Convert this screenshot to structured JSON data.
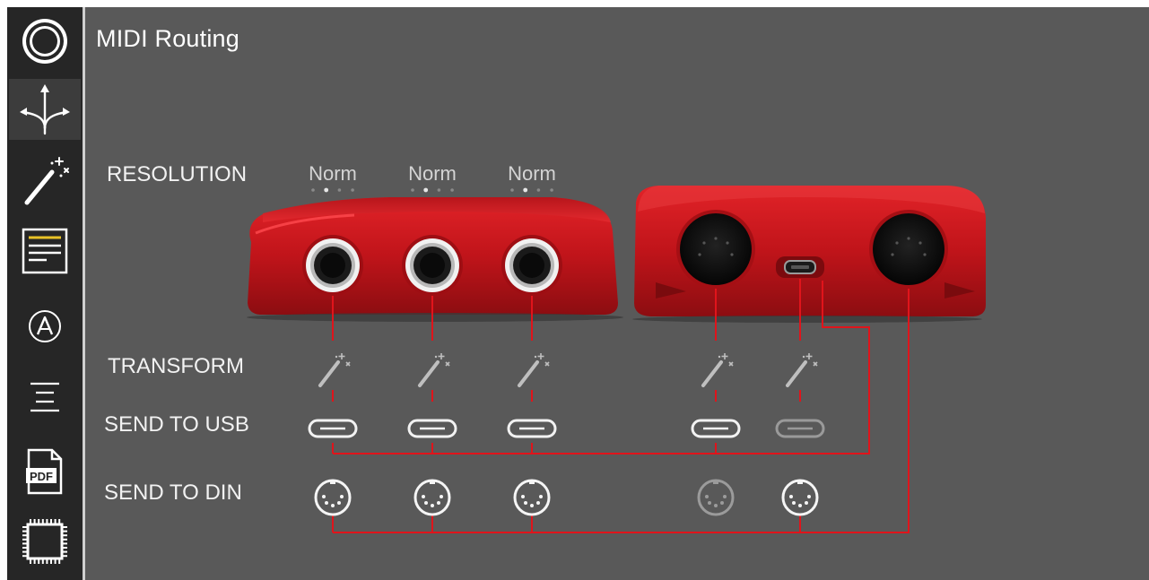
{
  "sidebar": {
    "items": [
      {
        "name": "record-icon",
        "active": false
      },
      {
        "name": "routing-arrows-icon",
        "active": true
      },
      {
        "name": "magic-wand-icon",
        "active": false
      },
      {
        "name": "text-panel-icon",
        "active": false
      },
      {
        "name": "circle-a-icon",
        "active": false
      },
      {
        "name": "list-icon",
        "active": false
      },
      {
        "name": "pdf-icon",
        "active": false,
        "label": "PDF"
      },
      {
        "name": "chip-icon",
        "active": false
      }
    ]
  },
  "page": {
    "title": "MIDI Routing",
    "row_labels": {
      "resolution": "RESOLUTION",
      "transform": "TRANSFORM",
      "send_usb": "SEND TO USB",
      "send_din": "SEND TO DIN"
    },
    "resolution_values": [
      "Norm",
      "Norm",
      "Norm"
    ],
    "resolution_steps": 4,
    "resolution_selected_index": 1
  },
  "ports": [
    {
      "id": "jack-1",
      "type": "jack",
      "send_to_usb": true,
      "send_to_din": true
    },
    {
      "id": "jack-2",
      "type": "jack",
      "send_to_usb": true,
      "send_to_din": true
    },
    {
      "id": "jack-3",
      "type": "jack",
      "send_to_usb": true,
      "send_to_din": true
    },
    {
      "id": "din-in",
      "type": "din",
      "send_to_usb": true,
      "send_to_din": false
    },
    {
      "id": "usb",
      "type": "usb",
      "send_to_usb": false,
      "send_to_din": true
    }
  ],
  "colors": {
    "background": "#595959",
    "sidebar": "#262626",
    "device_red": "#c8161c",
    "route_line": "#e0141b",
    "accent_yellow": "#e8c227"
  }
}
